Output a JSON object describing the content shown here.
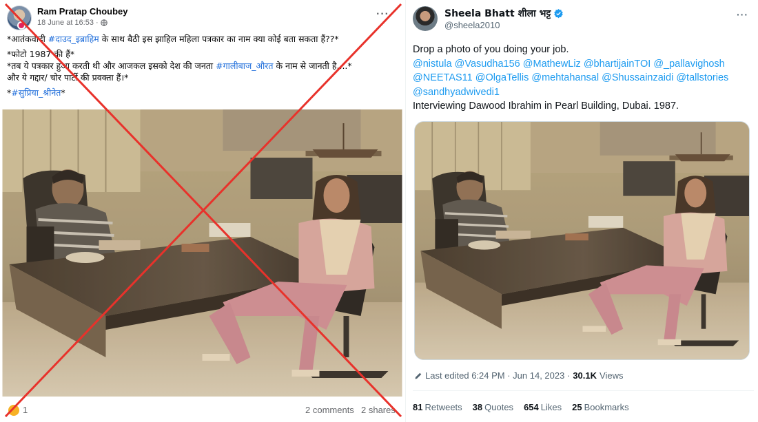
{
  "facebook": {
    "author": "Ram Pratap Choubey",
    "date": "18 June at 16:53 ·",
    "caption_line1_start": "*आतंकवादी ",
    "caption_line1_tag": "#दाउद_इब्राहिम",
    "caption_line1_end": " के साथ बैठी इस झाहिल महिला पत्रकार का नाम क्या कोई बता सकता हैं??*",
    "caption_line2": "*फोटो 1987 की हैं*",
    "caption_line3_start": "*तब ये पत्रकार हुआ करती थी और आजकल इसको देश की जनता ",
    "caption_line3_tag": "#गालीबाज_औरत",
    "caption_line3_end": " के नाम से जानती है....*",
    "caption_line4": "और ये गद्दार/ चोर पार्टी की प्रवक्ता हैं।*",
    "caption_line5_tag": "#सुप्रिया_श्रीनेत",
    "caption_line5_end": "*",
    "caption_line5_start": "*",
    "reaction_count": "1",
    "comments": "2 comments",
    "shares": "2 shares",
    "cross_color": "#e8322b"
  },
  "tweet": {
    "name": "Sheela Bhatt शीला भट्ट",
    "handle": "@sheela2010",
    "text_line1": "Drop a photo of you doing your job.",
    "mentions_line1": "@nistula @Vasudha156 @MathewLiz @bhartijainTOI @_pallavighosh",
    "mentions_line2": "@NEETAS11 @OlgaTellis @mehtahansal @Shussainzaidi @tallstories",
    "mentions_line3": "@sandhyadwivedi1",
    "text_line2": "Interviewing Dawood Ibrahim in Pearl Building, Dubai. 1987.",
    "edited": "Last edited 6:24 PM · Jun 14, 2023 ·",
    "views_count": "30.1K",
    "views_label": "Views",
    "retweets_count": "81",
    "retweets_label": "Retweets",
    "quotes_count": "38",
    "quotes_label": "Quotes",
    "likes_count": "654",
    "likes_label": "Likes",
    "bookmarks_count": "25",
    "bookmarks_label": "Bookmarks",
    "verified_color": "#1d9bf0",
    "mention_color": "#1d9bf0"
  }
}
